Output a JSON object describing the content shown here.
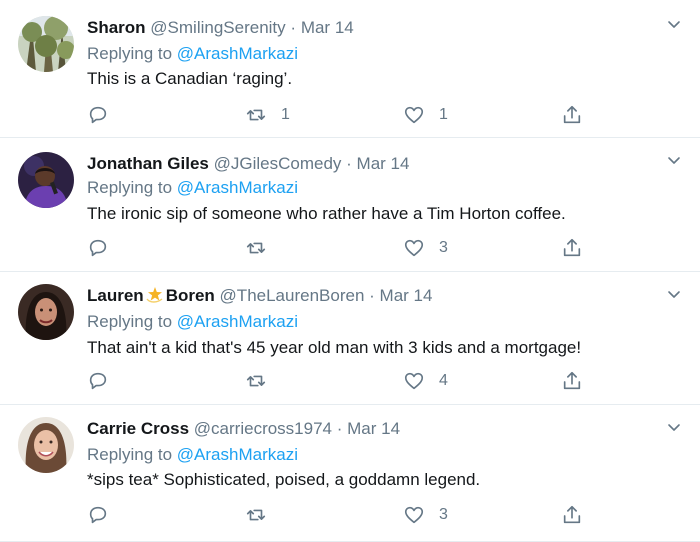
{
  "reply_prefix": "Replying to",
  "tweets": [
    {
      "name": "Sharon",
      "handle": "@SmilingSerenity",
      "date": "Mar 14",
      "reply_to": "@ArashMarkazi",
      "text": "This is a Canadian ‘raging’.",
      "replies": "",
      "retweets": "1",
      "likes": "1",
      "avatar_icon": "tree-photo-avatar"
    },
    {
      "name": "Jonathan Giles",
      "handle": "@JGilesComedy",
      "date": "Mar 14",
      "reply_to": "@ArashMarkazi",
      "text": "The ironic sip of someone who rather have a Tim Horton coffee.",
      "replies": "",
      "retweets": "",
      "likes": "3",
      "avatar_icon": "comedian-photo-avatar"
    },
    {
      "name_first": "Lauren",
      "name_last": "Boren",
      "name_emoji": "dizzy-star-icon",
      "handle": "@TheLaurenBoren",
      "date": "Mar 14",
      "reply_to": "@ArashMarkazi",
      "text": "That ain't a kid that's 45 year old man with 3 kids and a mortgage!",
      "replies": "",
      "retweets": "",
      "likes": "4",
      "avatar_icon": "woman-photo-avatar"
    },
    {
      "name": "Carrie Cross",
      "handle": "@carriecross1974",
      "date": "Mar 14",
      "reply_to": "@ArashMarkazi",
      "text": "*sips tea* Sophisticated, poised, a goddamn legend.",
      "replies": "",
      "retweets": "",
      "likes": "3",
      "avatar_icon": "woman-photo-avatar"
    }
  ],
  "colors": {
    "text": "#14171a",
    "muted": "#657786",
    "link": "#1da1f2",
    "divider": "#e6ecf0"
  }
}
